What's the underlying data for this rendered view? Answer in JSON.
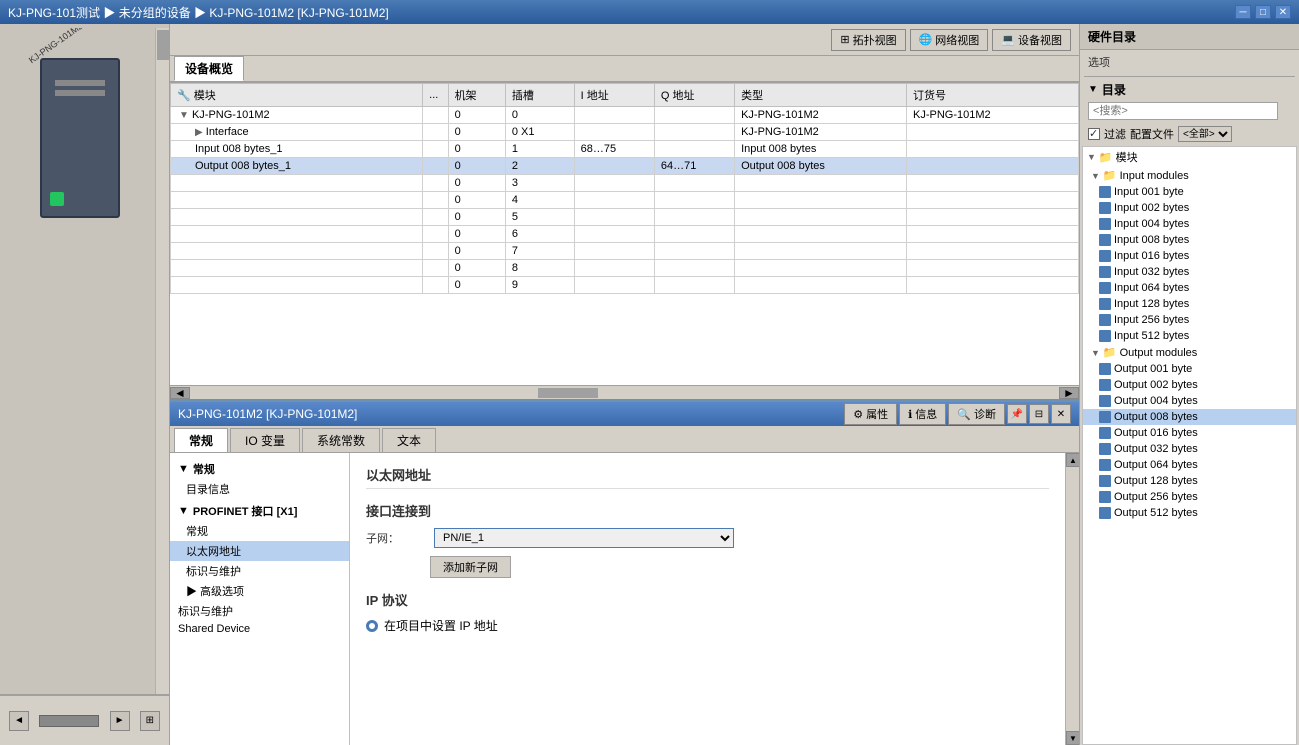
{
  "titlebar": {
    "text": "KJ-PNG-101测试 ▶ 未分组的设备 ▶ KJ-PNG-101M2 [KJ-PNG-101M2]",
    "min": "─",
    "restore": "□",
    "close": "✕"
  },
  "toolbar": {
    "topo_btn": "拓扑视图",
    "network_btn": "网络视图",
    "device_btn": "设备视图"
  },
  "device_overview": {
    "tab_label": "设备概览",
    "columns": [
      "模块",
      "...",
      "机架",
      "插槽",
      "I 地址",
      "Q 地址",
      "类型",
      "订货号"
    ],
    "rows": [
      {
        "indent": 0,
        "arrow": "▼",
        "name": "KJ-PNG-101M2",
        "rack": "0",
        "slot": "0",
        "iaddr": "",
        "qaddr": "",
        "type": "KJ-PNG-101M2",
        "order": "KJ-PNG-101M2",
        "selected": false
      },
      {
        "indent": 1,
        "arrow": "▶",
        "name": "Interface",
        "rack": "0",
        "slot": "0 X1",
        "iaddr": "",
        "qaddr": "",
        "type": "KJ-PNG-101M2",
        "order": "",
        "selected": false
      },
      {
        "indent": 1,
        "arrow": "",
        "name": "Input 008 bytes_1",
        "rack": "0",
        "slot": "1",
        "iaddr": "68…75",
        "qaddr": "",
        "type": "Input 008 bytes",
        "order": "",
        "selected": false
      },
      {
        "indent": 1,
        "arrow": "",
        "name": "Output 008 bytes_1",
        "rack": "0",
        "slot": "2",
        "iaddr": "",
        "qaddr": "64…71",
        "type": "Output 008 bytes",
        "order": "",
        "selected": true
      },
      {
        "indent": 0,
        "arrow": "",
        "name": "",
        "rack": "0",
        "slot": "3",
        "iaddr": "",
        "qaddr": "",
        "type": "",
        "order": "",
        "selected": false
      },
      {
        "indent": 0,
        "arrow": "",
        "name": "",
        "rack": "0",
        "slot": "4",
        "iaddr": "",
        "qaddr": "",
        "type": "",
        "order": "",
        "selected": false
      },
      {
        "indent": 0,
        "arrow": "",
        "name": "",
        "rack": "0",
        "slot": "5",
        "iaddr": "",
        "qaddr": "",
        "type": "",
        "order": "",
        "selected": false
      },
      {
        "indent": 0,
        "arrow": "",
        "name": "",
        "rack": "0",
        "slot": "6",
        "iaddr": "",
        "qaddr": "",
        "type": "",
        "order": "",
        "selected": false
      },
      {
        "indent": 0,
        "arrow": "",
        "name": "",
        "rack": "0",
        "slot": "7",
        "iaddr": "",
        "qaddr": "",
        "type": "",
        "order": "",
        "selected": false
      },
      {
        "indent": 0,
        "arrow": "",
        "name": "",
        "rack": "0",
        "slot": "8",
        "iaddr": "",
        "qaddr": "",
        "type": "",
        "order": "",
        "selected": false
      },
      {
        "indent": 0,
        "arrow": "",
        "name": "",
        "rack": "0",
        "slot": "9",
        "iaddr": "",
        "qaddr": "",
        "type": "",
        "order": "",
        "selected": false
      }
    ]
  },
  "bottom_panel": {
    "title": "KJ-PNG-101M2 [KJ-PNG-101M2]",
    "tabs": [
      "常规",
      "IO 变量",
      "系统常数",
      "文本"
    ],
    "right_tabs": [
      "属性",
      "信息",
      "诊断"
    ],
    "nav_tree": [
      {
        "label": "常规",
        "level": 0,
        "type": "section",
        "bold": true
      },
      {
        "label": "目录信息",
        "level": 1,
        "type": "item"
      },
      {
        "label": "PROFINET 接口 [X1]",
        "level": 0,
        "type": "section",
        "bold": true
      },
      {
        "label": "常规",
        "level": 1,
        "type": "item"
      },
      {
        "label": "以太网地址",
        "level": 1,
        "type": "item",
        "selected": true
      },
      {
        "label": "标识与维护",
        "level": 1,
        "type": "item"
      },
      {
        "label": "▶ 高级选项",
        "level": 1,
        "type": "item"
      },
      {
        "label": "标识与维护",
        "level": 0,
        "type": "item"
      },
      {
        "label": "Shared Device",
        "level": 0,
        "type": "item"
      }
    ],
    "content": {
      "section_title": "以太网地址",
      "interface_section": "接口连接到",
      "subnet_label": "子网：",
      "subnet_value": "PN/IE_1",
      "add_subnet_btn": "添加新子网",
      "ip_section": "IP 协议",
      "ip_radio_label": "在项目中设置 IP 地址"
    }
  },
  "right_sidebar": {
    "header": "硬件目录",
    "options_label": "选项",
    "catalog_section": "目录",
    "search_placeholder": "<搜索>",
    "filter_label": "过滤",
    "config_label": "配置文件",
    "config_value": "<全部>",
    "tree": {
      "modules_label": "模块",
      "input_modules_label": "Input modules",
      "input_items": [
        "Input 001 byte",
        "Input 002 bytes",
        "Input 004 bytes",
        "Input 008 bytes",
        "Input 016 bytes",
        "Input 032 bytes",
        "Input 064 bytes",
        "Input 128 bytes",
        "Input 256 bytes",
        "Input 512 bytes"
      ],
      "output_modules_label": "Output modules",
      "output_items": [
        "Output 001 byte",
        "Output 002 bytes",
        "Output 004 bytes",
        "Output 008 bytes",
        "Output 016 bytes",
        "Output 032 bytes",
        "Output 064 bytes",
        "Output 128 bytes",
        "Output 256 bytes",
        "Output 512 bytes"
      ]
    }
  },
  "icons": {
    "folder": "📁",
    "arrow_right": "▶",
    "arrow_down": "▼",
    "check": "✓",
    "wrench": "🔧",
    "network": "🌐",
    "device": "💻",
    "info": "ℹ",
    "diag": "🔍"
  }
}
